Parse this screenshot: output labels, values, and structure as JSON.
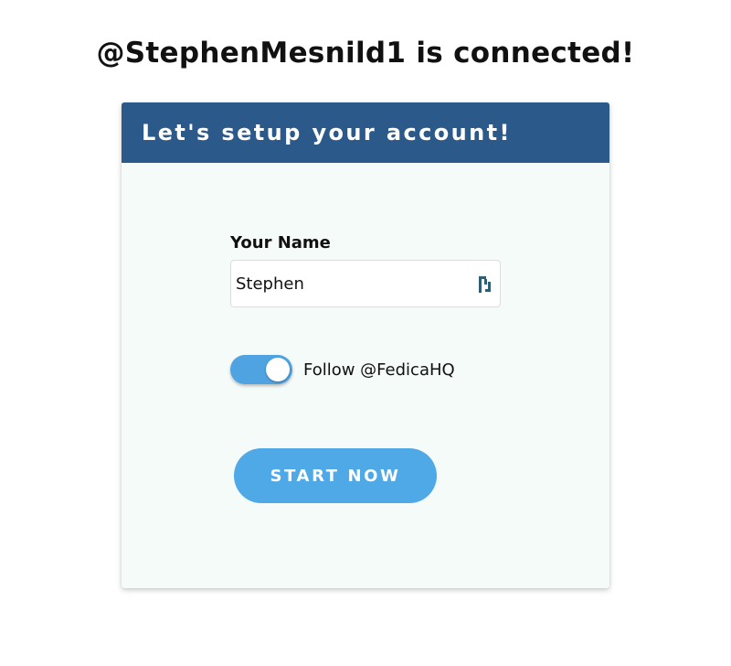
{
  "headline": "@StephenMesnild1 is connected!",
  "card": {
    "title": "Let's setup your account!"
  },
  "form": {
    "name_label": "Your Name",
    "name_value": "Stephen",
    "name_icon": "password-manager-icon",
    "follow_label": "Follow @FedicaHQ",
    "follow_enabled": true,
    "submit_label": "START NOW"
  },
  "colors": {
    "header_bg": "#2b5a8a",
    "card_bg": "#f5fbf9",
    "accent": "#4fa9e6",
    "text": "#111111"
  }
}
